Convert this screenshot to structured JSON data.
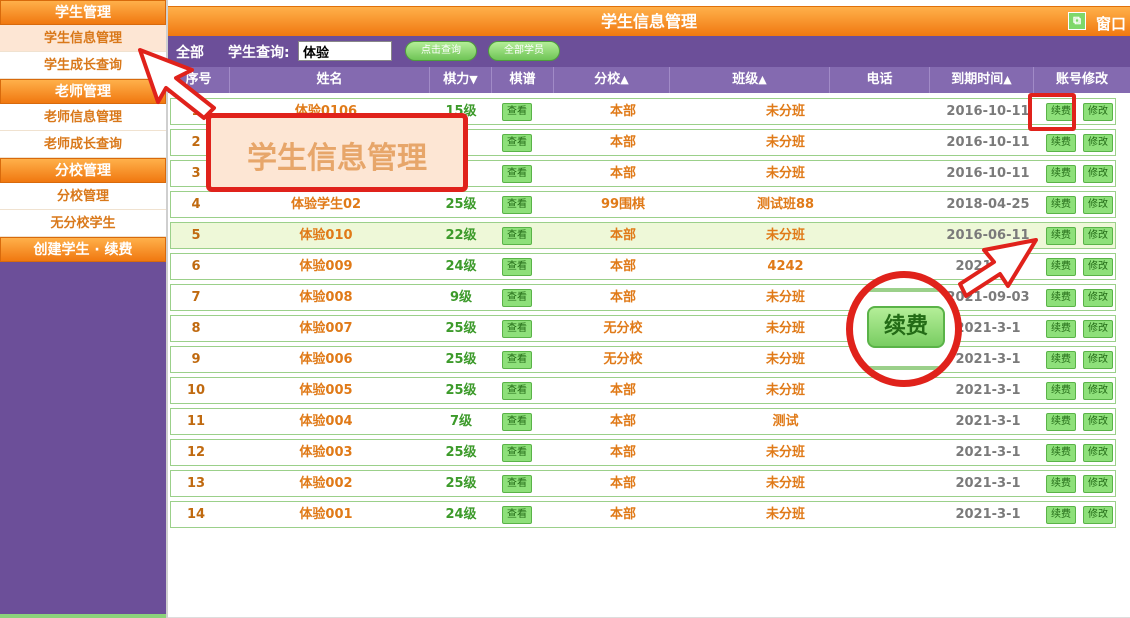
{
  "sidebar": {
    "sections": [
      {
        "heading": "学生管理",
        "items": [
          {
            "label": "学生信息管理",
            "active": true
          },
          {
            "label": "学生成长查询",
            "active": false
          }
        ]
      },
      {
        "heading": "老师管理",
        "items": [
          {
            "label": "老师信息管理",
            "active": false
          },
          {
            "label": "老师成长查询",
            "active": false
          }
        ]
      },
      {
        "heading": "分校管理",
        "items": [
          {
            "label": "分校管理",
            "active": false
          },
          {
            "label": "无分校学生",
            "active": false
          }
        ]
      },
      {
        "heading": "创建学生 · 续费",
        "items": []
      }
    ]
  },
  "header": {
    "title": "学生信息管理",
    "window_label": "窗口"
  },
  "toolbar": {
    "all_label": "全部",
    "search_label": "学生查询:",
    "search_value": "体验",
    "query_button": "点击查询",
    "all_students_button": "全部学员"
  },
  "table": {
    "columns": {
      "seq": "序号",
      "name": "姓名",
      "level": "棋力",
      "record": "棋谱",
      "branch": "分校",
      "class": "班级",
      "phone": "电话",
      "expire": "到期时间",
      "account": "账号修改"
    },
    "sort_icons": {
      "down": "▼",
      "up": "▲"
    },
    "action_view": "查看",
    "action_renew": "续费",
    "action_modify": "修改",
    "rows": [
      {
        "seq": "1",
        "name": "体验0106",
        "level": "15级",
        "branch": "本部",
        "class": "未分班",
        "phone": "",
        "expire": "2016-10-11"
      },
      {
        "seq": "2",
        "name": "",
        "level": "",
        "branch": "本部",
        "class": "未分班",
        "phone": "",
        "expire": "2016-10-11"
      },
      {
        "seq": "3",
        "name": "",
        "level": "",
        "branch": "本部",
        "class": "未分班",
        "phone": "",
        "expire": "2016-10-11"
      },
      {
        "seq": "4",
        "name": "体验学生02",
        "level": "25级",
        "branch": "99围棋",
        "class": "测试班88",
        "phone": "",
        "expire": "2018-04-25"
      },
      {
        "seq": "5",
        "name": "体验010",
        "level": "22级",
        "branch": "本部",
        "class": "未分班",
        "phone": "",
        "expire": "2016-06-11",
        "highlight": true
      },
      {
        "seq": "6",
        "name": "体验009",
        "level": "24级",
        "branch": "本部",
        "class": "4242",
        "phone": "",
        "expire": "2021-3-1"
      },
      {
        "seq": "7",
        "name": "体验008",
        "level": "9级",
        "branch": "本部",
        "class": "未分班",
        "phone": "",
        "expire": "2021-09-03"
      },
      {
        "seq": "8",
        "name": "体验007",
        "level": "25级",
        "branch": "无分校",
        "class": "未分班",
        "phone": "",
        "expire": "2021-3-1"
      },
      {
        "seq": "9",
        "name": "体验006",
        "level": "25级",
        "branch": "无分校",
        "class": "未分班",
        "phone": "",
        "expire": "2021-3-1"
      },
      {
        "seq": "10",
        "name": "体验005",
        "level": "25级",
        "branch": "本部",
        "class": "未分班",
        "phone": "",
        "expire": "2021-3-1"
      },
      {
        "seq": "11",
        "name": "体验004",
        "level": "7级",
        "branch": "本部",
        "class": "测试",
        "phone": "",
        "expire": "2021-3-1"
      },
      {
        "seq": "12",
        "name": "体验003",
        "level": "25级",
        "branch": "本部",
        "class": "未分班",
        "phone": "",
        "expire": "2021-3-1"
      },
      {
        "seq": "13",
        "name": "体验002",
        "level": "25级",
        "branch": "本部",
        "class": "未分班",
        "phone": "",
        "expire": "2021-3-1"
      },
      {
        "seq": "14",
        "name": "体验001",
        "level": "24级",
        "branch": "本部",
        "class": "未分班",
        "phone": "",
        "expire": "2021-3-1"
      }
    ]
  },
  "annotations": {
    "callout_text": "学生信息管理",
    "zoom_text": "续费"
  },
  "colors": {
    "accent_orange": "#f07810",
    "purple": "#6c4f99",
    "green_button": "#8ee07a",
    "annotation_red": "#e0221b"
  }
}
